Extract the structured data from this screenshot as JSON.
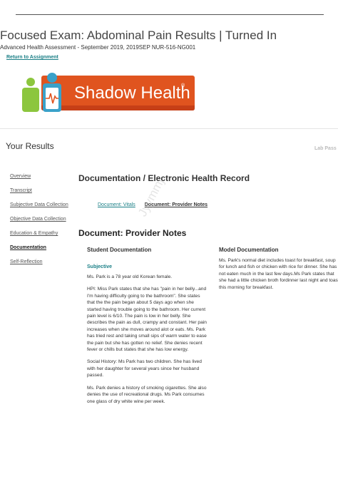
{
  "header": {
    "title": "Focused Exam: Abdominal Pain Results | Turned In",
    "subtitle": "Advanced Health Assessment - September 2019, 2019SEP NUR-516-NG001",
    "return_link": "Return to Assignment"
  },
  "logo": {
    "text": "Shadow Health",
    "registered_mark": "®",
    "colors": {
      "banner": "#e0541f",
      "banner_dark": "#c63f17",
      "figure_green": "#8cc63e",
      "figure_blue": "#3aa1c9"
    }
  },
  "results": {
    "title": "Your Results",
    "lab_pass": "Lab Pass"
  },
  "nav": {
    "items": [
      {
        "label": "Overview"
      },
      {
        "label": "Transcript"
      },
      {
        "label": "Subjective Data Collection"
      },
      {
        "label": "Objective Data Collection"
      },
      {
        "label": "Education & Empathy"
      },
      {
        "label": "Documentation"
      },
      {
        "label": "Self-Reflection"
      }
    ],
    "active_index": 5
  },
  "documentation": {
    "heading": "Documentation / Electronic Health Record",
    "tabs": [
      {
        "label": "Document: Vitals"
      },
      {
        "label": "Document: Provider Notes"
      }
    ],
    "subheading": "Document: Provider Notes"
  },
  "student": {
    "heading": "Student Documentation",
    "section_label": "Subjective",
    "paragraphs": [
      "Ms. Park is a 78 year old Korean female.",
      "HPI: Miss Park states that she has \"pain in her belly...and I'm having difficulty going to the bathroom\". She states that the the pain began about 5 days ago when she started having trouble going to the bathroom. Her current pain level is 6/10. The pain is low in her belly. She describes the pain as dull, crampy and constant. Her pain increases when she moves around alot or eats. Ms. Park has tried rest and taking small sips of warm water to ease the pain but she has gotten no relief. She denies recent fever or chills but states that she has low energy.",
      "Social History: Ms Park has two children. She has lived with her daughter for several years since her husband passed.",
      "Ms. Park denies a history of smoking cigarettes. She also denies the use of recreational drugs. Ms Park consumes one glass of dry white wine per week."
    ]
  },
  "model": {
    "heading": "Model Documentation",
    "text": "Ms. Park's normal diet includes toast for breakfast, soup for lunch and fish or chicken with rice for dinner. She has not eaten much in the last few days.Ms Park states that she had a little chicken broth fordinner last night and toast this morning for breakfast."
  },
  "watermark": {
    "text": "Jyymmj"
  },
  "colors": {
    "accent_teal": "#1a7f86",
    "text_dark": "#333333"
  }
}
